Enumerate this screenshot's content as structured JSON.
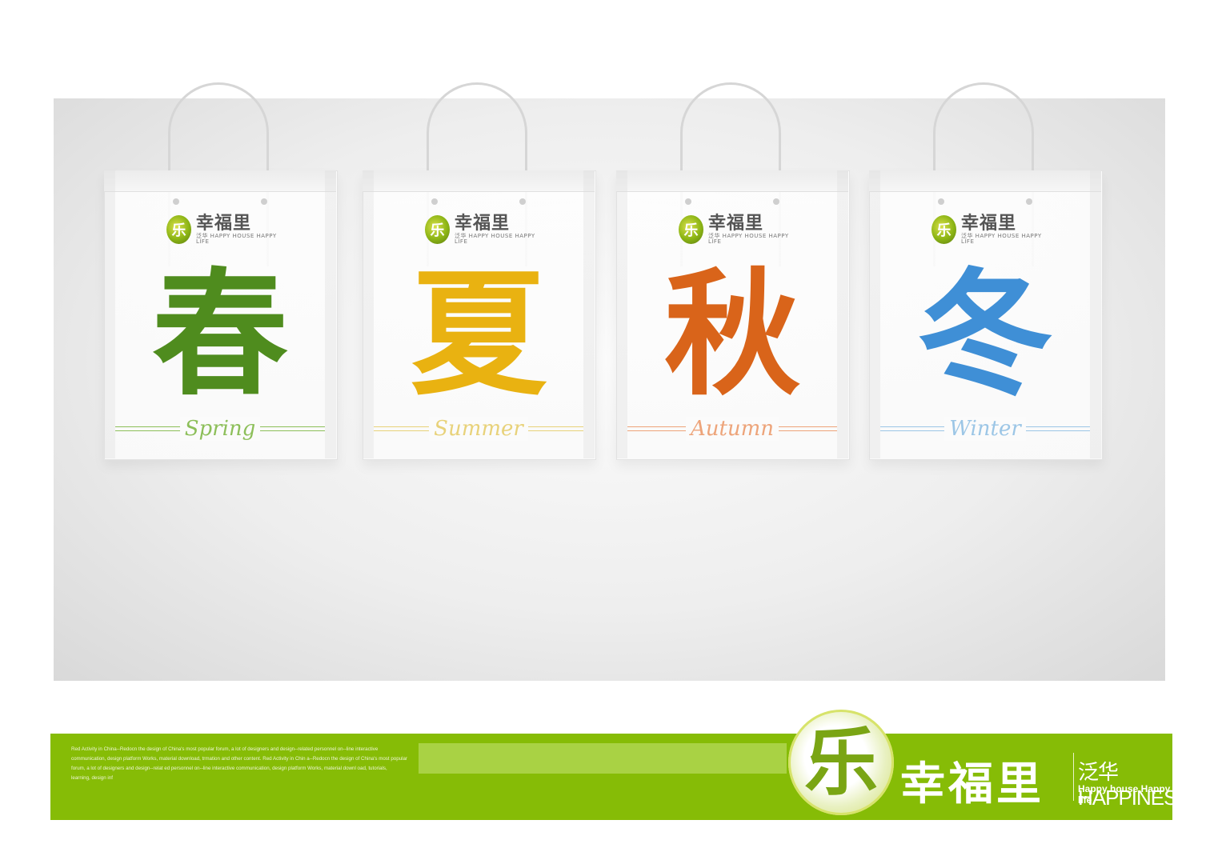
{
  "bags": [
    {
      "char": "春",
      "season": "Spring",
      "char_color": "#4f8c1e",
      "accent": "#8dbf5a"
    },
    {
      "char": "夏",
      "season": "Summer",
      "char_color": "#e9b211",
      "accent": "#e8d27a"
    },
    {
      "char": "秋",
      "season": "Autumn",
      "char_color": "#d9641a",
      "accent": "#eda47a"
    },
    {
      "char": "冬",
      "season": "Winter",
      "char_color": "#3f8fd6",
      "accent": "#9cc6e6"
    }
  ],
  "bag_logo": {
    "name": "幸福里",
    "tag": "泛华 HAPPY HOUSE HAPPY LIFE"
  },
  "footer": {
    "blurb": "Red Activity in China--Redocn the design of China's most popular forum, a lot of designers and design--related personnel on--line interactive communication, design platform Works, material download, trmation and other content. Red Activity in Chin a--Redocn the design of China's most popular forum, a lot of designers and design--relat ed personnel on--line interactive communication, design platform Works, material downl oad, tutorials, learning, design inf",
    "brand_name": "幸福里",
    "brand_sub1": "泛华HAPPINESS",
    "brand_sub2": "Happy house Happy life"
  },
  "colors": {
    "band": "#86bc06",
    "band_bar": "#a9d244"
  }
}
